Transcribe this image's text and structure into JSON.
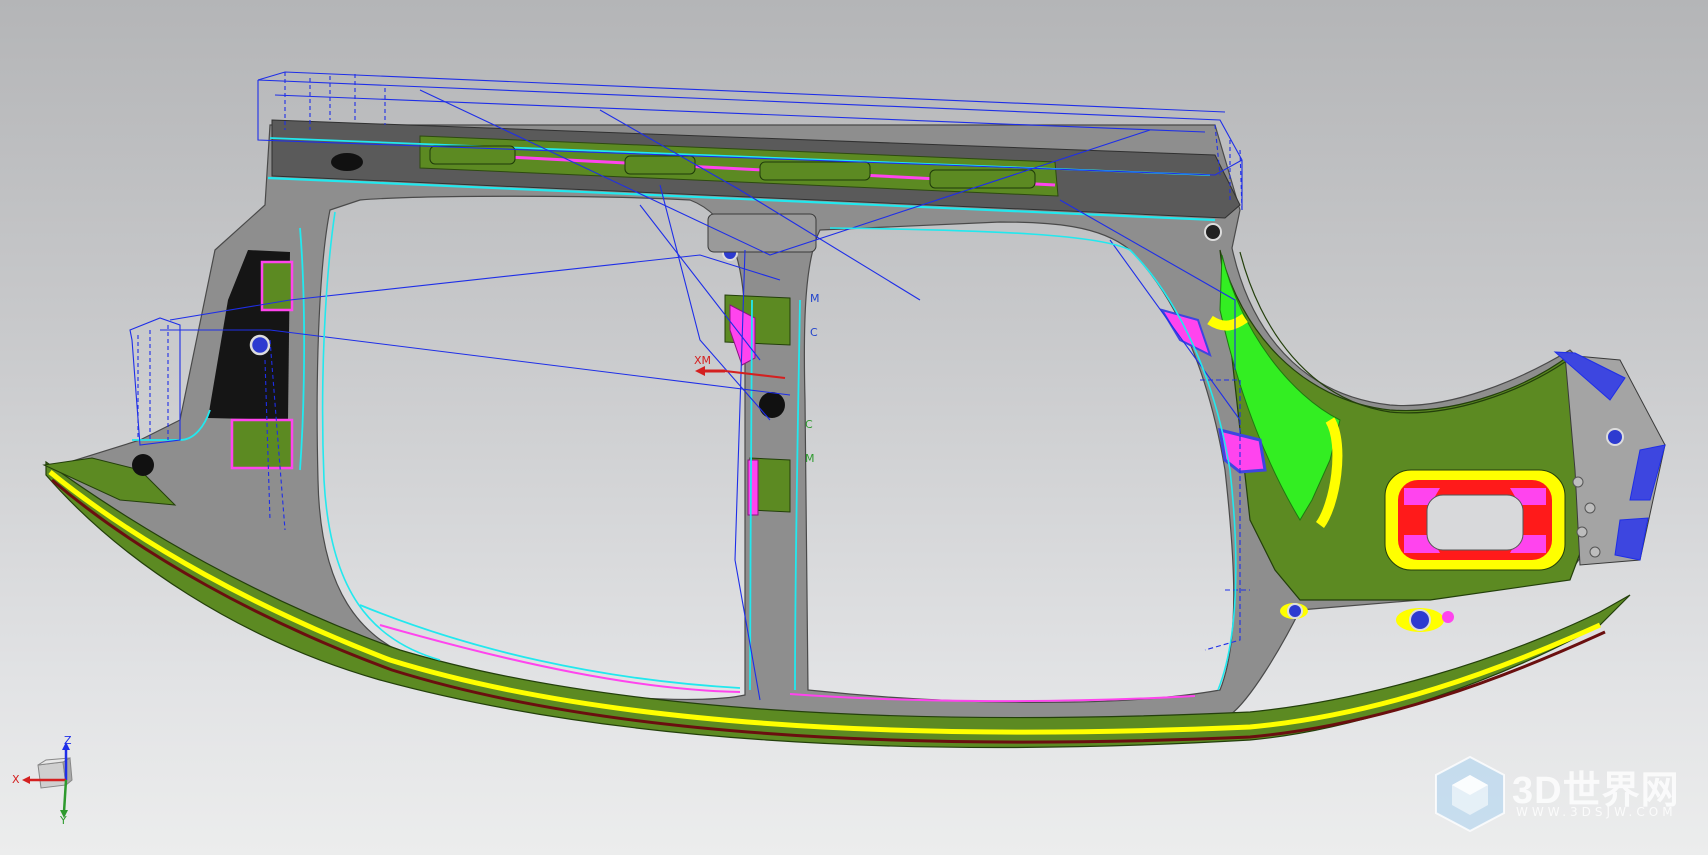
{
  "viewport": {
    "background_top": "#b4b5b7",
    "background_bottom": "#eceded"
  },
  "colors": {
    "panel_green": "#5c8a22",
    "panel_grey": "#8c8c8c",
    "flange_yellow": "#ffff00",
    "bright_green": "#33ee22",
    "magenta": "#ff44ee",
    "wire_blue": "#1e2ee8",
    "cyan_edge": "#22e8ee",
    "red_patch": "#ff1a1a",
    "dark_red_edge": "#6a0f0f"
  },
  "wcs": {
    "label": "XM",
    "markers": [
      "M",
      "C",
      "C",
      "M"
    ]
  },
  "axis_triad": {
    "x": "X",
    "y": "Y",
    "z": "Z"
  },
  "watermark": {
    "title": "3D世界网",
    "url": "WWW.3DSJW.COM"
  }
}
